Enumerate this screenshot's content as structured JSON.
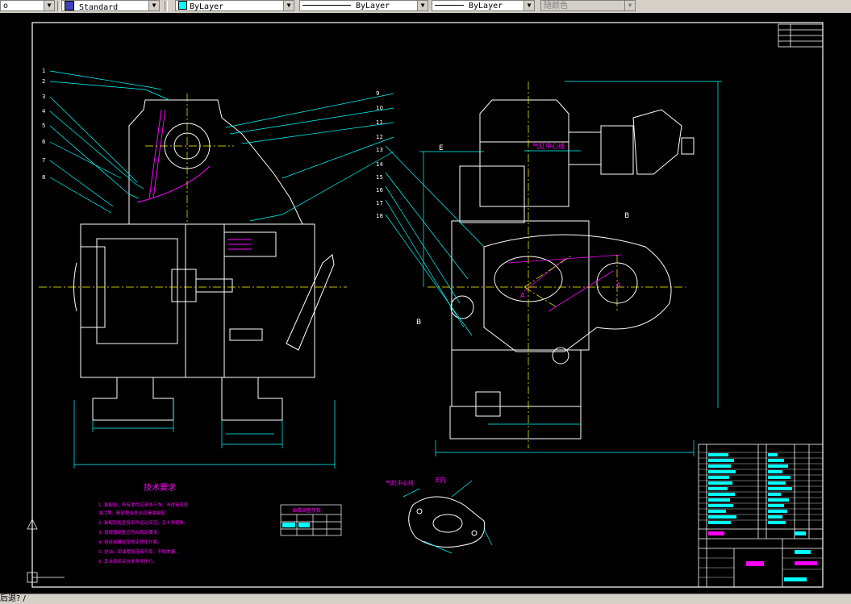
{
  "toolbar": {
    "left_combo_arrow": "▼",
    "text_style": "Standard",
    "layer": "ByLayer",
    "linetype": "ByLayer",
    "lineweight": "ByLayer",
    "plot_style": "随颜色"
  },
  "drawing": {
    "tech_req_title": "技术要求",
    "tech_req_lines": [
      "1. 装配前，所有零件应清洗干净，不得有毛刺",
      "   油污等。精密配合处涂润滑油装配。",
      "2. 装配后检查各部件运动灵活，无卡滞现象。",
      "3. 调速器调整应符合规定要求。",
      "4. 各连接螺栓按规定扭矩拧紧。",
      "5. 进油、回油管路连接可靠，不得渗漏。",
      "6. 其余按相关技术条件执行。"
    ],
    "small_table_title": "油泵调整参数",
    "view_label_e": "E",
    "view_label_b": "B",
    "view_label_a": "A",
    "view_e_title": "E向",
    "annotation_center": "气缸中心线",
    "annotation_center2": "气缸中心线",
    "part_numbers_left": [
      "1",
      "2",
      "3",
      "4",
      "5",
      "6",
      "7",
      "8"
    ],
    "part_numbers_right": [
      "9",
      "10",
      "11",
      "12",
      "13",
      "14",
      "15",
      "16",
      "17",
      "18"
    ]
  },
  "status": {
    "text": "后退? /"
  },
  "colors": {
    "frame": "#ffffff",
    "leader": "#00ffff",
    "center": "#ffff00",
    "hatch": "#ff00ff",
    "dimension": "#00ffff"
  }
}
